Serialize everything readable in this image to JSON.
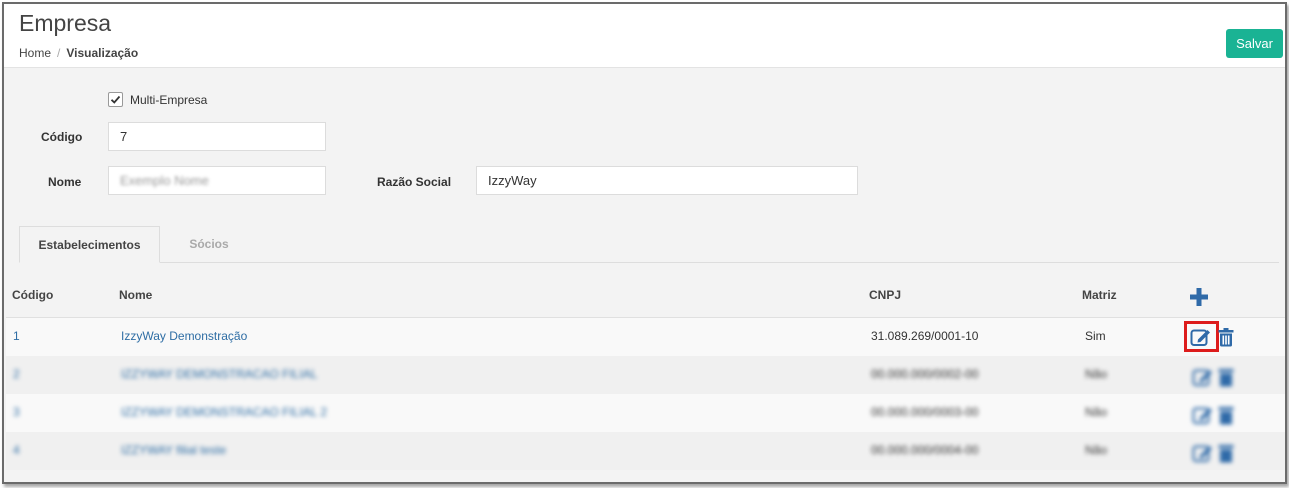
{
  "header": {
    "title": "Empresa",
    "breadcrumb": {
      "home": "Home",
      "separator": "/",
      "current": "Visualização"
    },
    "save_label": "Salvar"
  },
  "form": {
    "multi_empresa_label": "Multi-Empresa",
    "multi_empresa_checked": true,
    "codigo_label": "Código",
    "codigo_value": "7",
    "nome_label": "Nome",
    "nome_value": "Exemplo Nome",
    "razao_social_label": "Razão Social",
    "razao_social_value": "IzzyWay"
  },
  "tabs": [
    {
      "label": "Estabelecimentos",
      "active": true
    },
    {
      "label": "Sócios",
      "active": false
    }
  ],
  "table": {
    "columns": [
      "Código",
      "Nome",
      "CNPJ",
      "Matriz"
    ],
    "rows": [
      {
        "codigo": "1",
        "nome": "IzzyWay Demonstração",
        "cnpj": "31.089.269/0001-10",
        "matriz": "Sim"
      },
      {
        "codigo": "2",
        "nome": "IZZYWAY DEMONSTRACAO FILIAL",
        "cnpj": "00.000.000/0002-00",
        "matriz": "Não"
      },
      {
        "codigo": "3",
        "nome": "IZZYWAY DEMONSTRACAO FILIAL 2",
        "cnpj": "00.000.000/0003-00",
        "matriz": "Não"
      },
      {
        "codigo": "4",
        "nome": "IZZYWAY filial teste",
        "cnpj": "00.000.000/0004-00",
        "matriz": "Não"
      }
    ]
  },
  "icons": {
    "add": "plus-icon",
    "edit": "edit-icon",
    "delete": "trash-icon"
  },
  "colors": {
    "accent": "#1ab394",
    "link": "#2e6da4",
    "icon": "#2f6aa8",
    "highlight": "#dd1c1c"
  }
}
